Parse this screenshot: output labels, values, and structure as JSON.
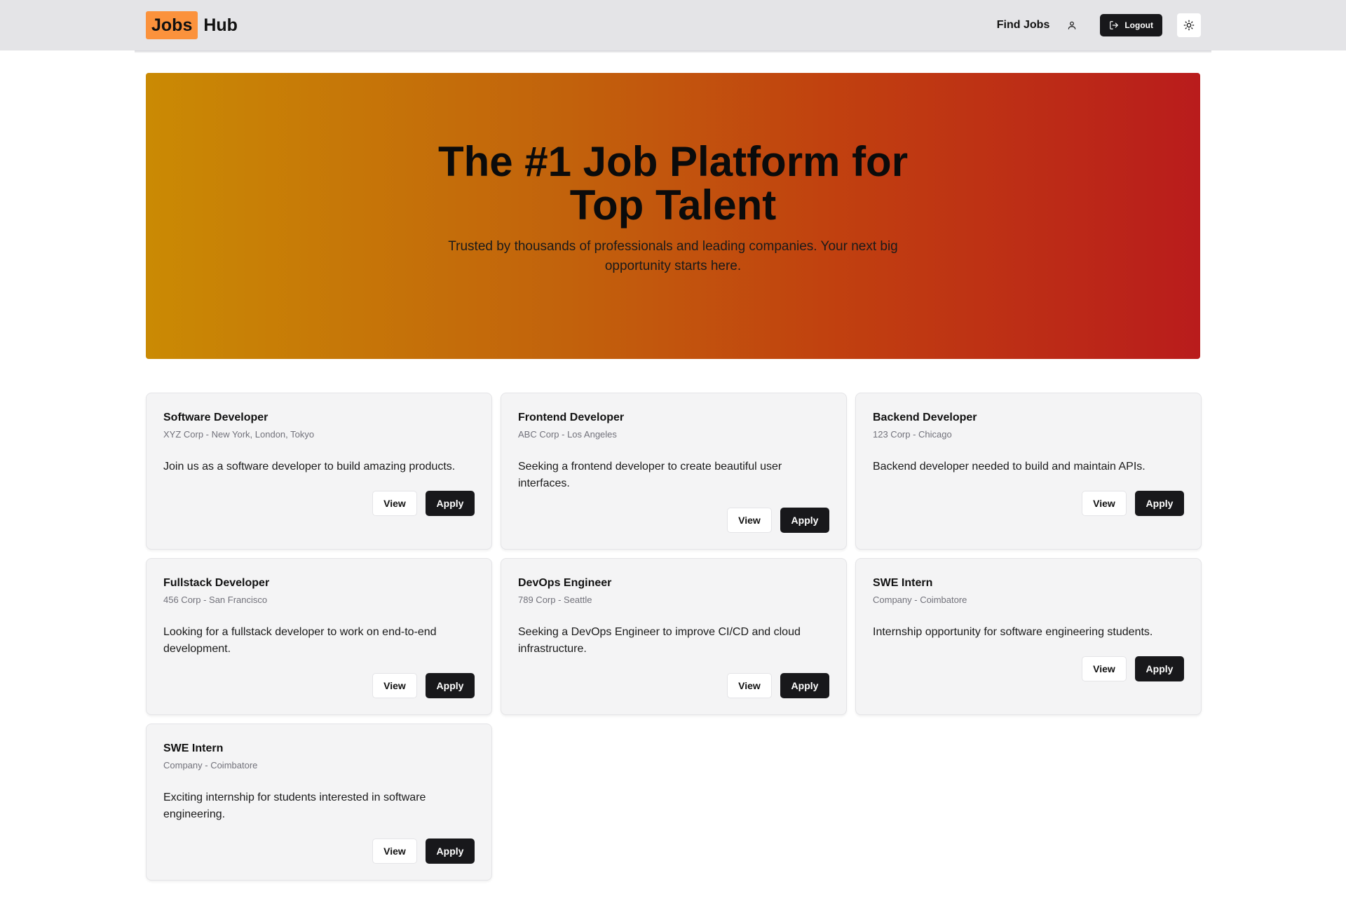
{
  "header": {
    "logo_part1": "Jobs",
    "logo_part2": "Hub",
    "nav_find_jobs": "Find Jobs",
    "logout_label": "Logout",
    "icons": {
      "user": "user-icon",
      "logout": "logout-icon",
      "theme": "sun-icon"
    }
  },
  "hero": {
    "title_line1": "The #1 Job Platform for",
    "title_line2": "Top Talent",
    "subtitle": "Trusted by thousands of professionals and leading companies. Your next big opportunity starts here."
  },
  "colors": {
    "logo_accent": "#fb923c",
    "hero_gradient_start": "#ca8a04",
    "hero_gradient_end": "#b91c1c",
    "primary_button": "#18181b"
  },
  "jobs": [
    {
      "title": "Software Developer",
      "meta": "XYZ Corp - New York, London, Tokyo",
      "description": "Join us as a software developer to build amazing products.",
      "view_label": "View",
      "apply_label": "Apply"
    },
    {
      "title": "Frontend Developer",
      "meta": "ABC Corp - Los Angeles",
      "description": "Seeking a frontend developer to create beautiful user interfaces.",
      "view_label": "View",
      "apply_label": "Apply"
    },
    {
      "title": "Backend Developer",
      "meta": "123 Corp - Chicago",
      "description": "Backend developer needed to build and maintain APIs.",
      "view_label": "View",
      "apply_label": "Apply"
    },
    {
      "title": "Fullstack Developer",
      "meta": "456 Corp - San Francisco",
      "description": "Looking for a fullstack developer to work on end-to-end development.",
      "view_label": "View",
      "apply_label": "Apply"
    },
    {
      "title": "DevOps Engineer",
      "meta": "789 Corp - Seattle",
      "description": "Seeking a DevOps Engineer to improve CI/CD and cloud infrastructure.",
      "view_label": "View",
      "apply_label": "Apply"
    },
    {
      "title": "SWE Intern",
      "meta": "Company - Coimbatore",
      "description": "Internship opportunity for software engineering students.",
      "view_label": "View",
      "apply_label": "Apply"
    },
    {
      "title": "SWE Intern",
      "meta": "Company - Coimbatore",
      "description": "Exciting internship for students interested in software engineering.",
      "view_label": "View",
      "apply_label": "Apply"
    }
  ]
}
